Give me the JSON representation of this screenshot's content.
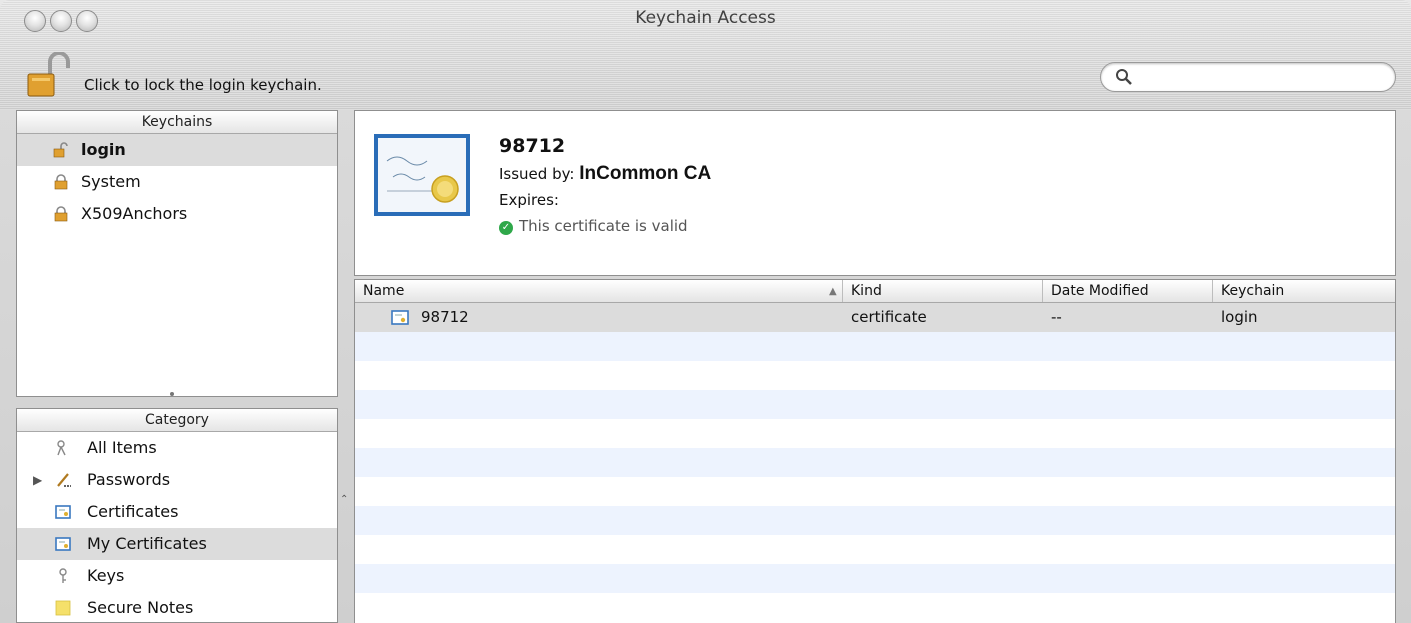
{
  "window": {
    "title": "Keychain Access"
  },
  "toolbar": {
    "lock_label": "Click to lock the login keychain.",
    "search_placeholder": ""
  },
  "keychains": {
    "header": "Keychains",
    "items": [
      {
        "label": "login",
        "icon": "lock-open-icon",
        "selected": true
      },
      {
        "label": "System",
        "icon": "lock-icon",
        "selected": false
      },
      {
        "label": "X509Anchors",
        "icon": "lock-icon",
        "selected": false
      }
    ]
  },
  "category": {
    "header": "Category",
    "items": [
      {
        "label": "All Items",
        "icon": "keys-icon"
      },
      {
        "label": "Passwords",
        "icon": "pen-icon"
      },
      {
        "label": "Certificates",
        "icon": "certificate-icon"
      },
      {
        "label": "My Certificates",
        "icon": "certificate-icon",
        "selected": true
      },
      {
        "label": "Keys",
        "icon": "key-icon"
      },
      {
        "label": "Secure Notes",
        "icon": "note-icon"
      }
    ]
  },
  "detail": {
    "name": "98712",
    "issued_by_label": "Issued by:",
    "issuer": "InCommon CA",
    "expires_label": "Expires:",
    "valid_text": "This certificate is valid"
  },
  "table": {
    "columns": [
      "Name",
      "Kind",
      "Date Modified",
      "Keychain"
    ],
    "rows": [
      {
        "name": "98712",
        "kind": "certificate",
        "date_modified": "--",
        "keychain": "login"
      }
    ]
  },
  "colors": {
    "selection": "#dcdcdc",
    "stripe": "#edf3fe",
    "valid_green": "#2fa84a"
  }
}
